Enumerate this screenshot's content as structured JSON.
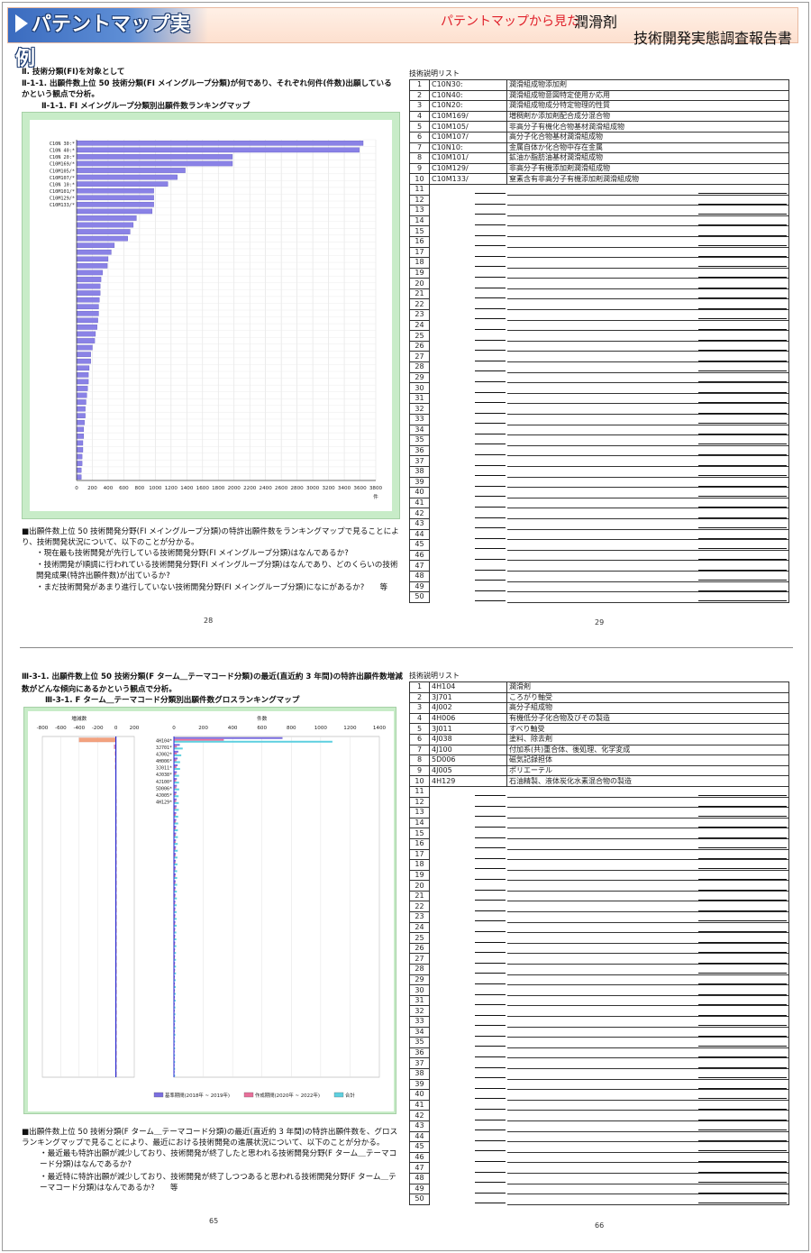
{
  "header": {
    "banner": "パテントマップ実例",
    "subtitle_prefix": "パテントマップから見た",
    "subtitle_main": "潤滑剤",
    "report_title": "技術開発実態調査報告書"
  },
  "section1": {
    "heading": "Ⅱ. 技術分類(FI)を対象として",
    "subheading": "Ⅱ-1-1. 出願件数上位 50 技術分類(FI メイングループ分類)が何であり、それぞれ何件(件数)出願しているかという観点で分析。",
    "map_title": "Ⅱ-1-1. FI メイングループ分類別出願件数ランキングマップ",
    "notes": [
      "■出願件数上位 50 技術開発分野(FI メイングループ分類)の特許出願件数をランキングマップで見ることにより、技術開発状況について、以下のことが分かる。",
      "・現在最も技術開発が先行している技術開発分野(FI メイングループ分類)はなんであるか?",
      "・技術開発が順調に行われている技術開発分野(FI メイングループ分類)はなんであり、どのくらいの技術開発成果(特許出願件数)が出ているか?",
      "・まだ技術開発があまり進行していない技術開発分野(FI メイングループ分類)になにがあるか?　　等"
    ],
    "page_left": "28",
    "page_right": "29",
    "table_title": "技術説明リスト",
    "table_rows": [
      {
        "n": "1",
        "code": "C10N30:",
        "desc": "潤滑組成物添加剤"
      },
      {
        "n": "2",
        "code": "C10N40:",
        "desc": "潤滑組成物意図特定使用か応用"
      },
      {
        "n": "3",
        "code": "C10N20:",
        "desc": "潤滑組成物成分特定物理的性質"
      },
      {
        "n": "4",
        "code": "C10M169/",
        "desc": "増稠剤か添加剤配合成分混合物"
      },
      {
        "n": "5",
        "code": "C10M105/",
        "desc": "非高分子有機化合物基材潤滑組成物"
      },
      {
        "n": "6",
        "code": "C10M107/",
        "desc": "高分子化合物基材潤滑組成物"
      },
      {
        "n": "7",
        "code": "C10N10:",
        "desc": "金属自体か化合物中存在金属"
      },
      {
        "n": "8",
        "code": "C10M101/",
        "desc": "鉱油か脂肪油基材潤滑組成物"
      },
      {
        "n": "9",
        "code": "C10M129/",
        "desc": "非高分子有機添加剤潤滑組成物"
      },
      {
        "n": "10",
        "code": "C10M133/",
        "desc": "窒素含有非高分子有機添加剤潤滑組成物"
      }
    ]
  },
  "section2": {
    "subheading": "Ⅲ-3-1. 出願件数上位 50 技術分類(F ターム＿テーマコード分類)の最近(直近約 3 年間)の特許出願件数増減数がどんな傾向にあるかという観点で分析。",
    "map_title": "Ⅲ-3-1. F ターム＿テーマコード分類別出願件数グロスランキングマップ",
    "notes": [
      "■出願件数上位 50 技術分類(F ターム＿テーマコード分類)の最近(直近約 3 年間)の特許出願件数を、グロスランキングマップで見ることにより、最近における技術開発の進展状況について、以下のことが分かる。",
      "・最近最も特許出願が減少しており、技術開発が終了したと思われる技術開発分野(F ターム＿テーマコード分類)はなんであるか?",
      "・最近特に特許出願が減少しており、技術開発が終了しつつあると思われる技術開発分野(F ターム＿テーマコード分類)はなんであるか?　　等"
    ],
    "page_left": "65",
    "page_right": "66",
    "table_title": "技術説明リスト",
    "table_rows": [
      {
        "n": "1",
        "code": "4H104",
        "desc": "潤滑剤"
      },
      {
        "n": "2",
        "code": "3J701",
        "desc": "ころがり軸受"
      },
      {
        "n": "3",
        "code": "4J002",
        "desc": "高分子組成物"
      },
      {
        "n": "4",
        "code": "4H006",
        "desc": "有機低分子化合物及びその製造"
      },
      {
        "n": "5",
        "code": "3J011",
        "desc": "すべり軸受"
      },
      {
        "n": "6",
        "code": "4J038",
        "desc": "塗料、除去剤"
      },
      {
        "n": "7",
        "code": "4J100",
        "desc": "付加系(共)重合体、後処理、化学変成"
      },
      {
        "n": "8",
        "code": "5D006",
        "desc": "磁気記録担体"
      },
      {
        "n": "9",
        "code": "4J005",
        "desc": "ポリエーテル"
      },
      {
        "n": "10",
        "code": "4H129",
        "desc": "石油精製、液体炭化水素混合物の製造"
      }
    ]
  },
  "chart_data": [
    {
      "type": "bar",
      "orientation": "horizontal",
      "title": "",
      "xlabel": "件",
      "ylabel": "",
      "xlim": [
        0,
        3800
      ],
      "xticks": [
        0,
        200,
        400,
        600,
        800,
        1000,
        1200,
        1400,
        1600,
        1800,
        2000,
        2200,
        2400,
        2600,
        2800,
        3000,
        3200,
        3400,
        3600,
        3800
      ],
      "categories": [
        "C10N 30:*",
        "C10N 40:*",
        "C10N 20:*",
        "C10M169/*",
        "C10M105/*",
        "C10M107/*",
        "C10N 10:*",
        "C10M101/*",
        "C10M129/*",
        "C10M133/*",
        "",
        "",
        "",
        "",
        "",
        "",
        "",
        "",
        "",
        "",
        "",
        "",
        "",
        "",
        "",
        "",
        "",
        "",
        "",
        "",
        "",
        "",
        "",
        "",
        "",
        "",
        "",
        "",
        "",
        "",
        "",
        "",
        "",
        "",
        "",
        "",
        "",
        "",
        "",
        ""
      ],
      "values": [
        3640,
        3590,
        1980,
        1980,
        1380,
        1280,
        1160,
        980,
        980,
        980,
        960,
        760,
        720,
        680,
        650,
        480,
        440,
        400,
        390,
        330,
        310,
        300,
        300,
        290,
        280,
        280,
        270,
        260,
        240,
        230,
        200,
        180,
        180,
        160,
        150,
        150,
        140,
        130,
        120,
        110,
        110,
        100,
        90,
        90,
        80,
        80,
        70,
        70,
        60,
        60
      ],
      "grid": true,
      "color": "#7b6fe0"
    },
    {
      "type": "bar",
      "orientation": "horizontal",
      "title": "",
      "xlabel_left": "増減数",
      "xlabel_right": "件数",
      "xlim_left": [
        -800,
        200
      ],
      "xticks_left": [
        -800,
        -600,
        -400,
        -200,
        0,
        200
      ],
      "xlim_right": [
        0,
        1400
      ],
      "xticks_right": [
        0,
        200,
        400,
        600,
        800,
        1000,
        1200,
        1400
      ],
      "categories": [
        "4H104*",
        "3J701*",
        "4J002*",
        "4H006*",
        "3J011*",
        "4J038*",
        "4J100*",
        "5D006*",
        "4J005*",
        "4H129*"
      ],
      "diff_values": [
        -400,
        -20,
        -10,
        -8,
        -8,
        -5,
        -5,
        -4,
        -4,
        -3,
        -3,
        -3,
        -3,
        -3,
        -3,
        -2,
        -2,
        -2,
        -2,
        -2,
        -2,
        -2,
        -2,
        -2,
        -2,
        -2,
        -2,
        -2,
        -2,
        -2,
        -2,
        -2,
        -2,
        -2,
        -2,
        -2,
        -2,
        -2,
        -2,
        -2,
        -2,
        -2,
        -2,
        -2,
        -2,
        -2,
        -2,
        -2,
        -2,
        -2
      ],
      "series": [
        {
          "name": "基準期間(2018年 ~ 2019年)",
          "color": "#7b6fe0",
          "values": [
            740,
            40,
            30,
            25,
            25,
            20,
            20,
            20,
            18,
            18,
            18,
            16,
            16,
            15,
            15,
            14,
            14,
            13,
            13,
            12,
            12,
            12,
            11,
            11,
            10,
            10,
            10,
            10,
            9,
            9,
            9,
            8,
            8,
            8,
            8,
            7,
            7,
            7,
            7,
            6,
            6,
            6,
            6,
            6,
            5,
            5,
            5,
            5,
            5,
            5
          ]
        },
        {
          "name": "作成期間(2020年 ~ 2022年)",
          "color": "#e8709a",
          "values": [
            340,
            20,
            20,
            17,
            17,
            15,
            15,
            16,
            14,
            15,
            15,
            13,
            13,
            12,
            12,
            12,
            12,
            11,
            11,
            10,
            10,
            10,
            9,
            9,
            8,
            8,
            8,
            8,
            7,
            7,
            7,
            6,
            6,
            6,
            6,
            5,
            5,
            5,
            5,
            4,
            4,
            4,
            4,
            4,
            3,
            3,
            3,
            3,
            3,
            3
          ]
        },
        {
          "name": "合計",
          "color": "#5fd0e0",
          "values": [
            1080,
            60,
            50,
            42,
            42,
            35,
            35,
            36,
            32,
            33,
            33,
            29,
            29,
            27,
            27,
            26,
            26,
            24,
            24,
            22,
            22,
            22,
            20,
            20,
            18,
            18,
            18,
            18,
            16,
            16,
            16,
            14,
            14,
            14,
            14,
            12,
            12,
            12,
            12,
            10,
            10,
            10,
            10,
            10,
            8,
            8,
            8,
            8,
            8,
            8
          ]
        }
      ],
      "legend_position": "bottom-right",
      "grid": true
    }
  ]
}
